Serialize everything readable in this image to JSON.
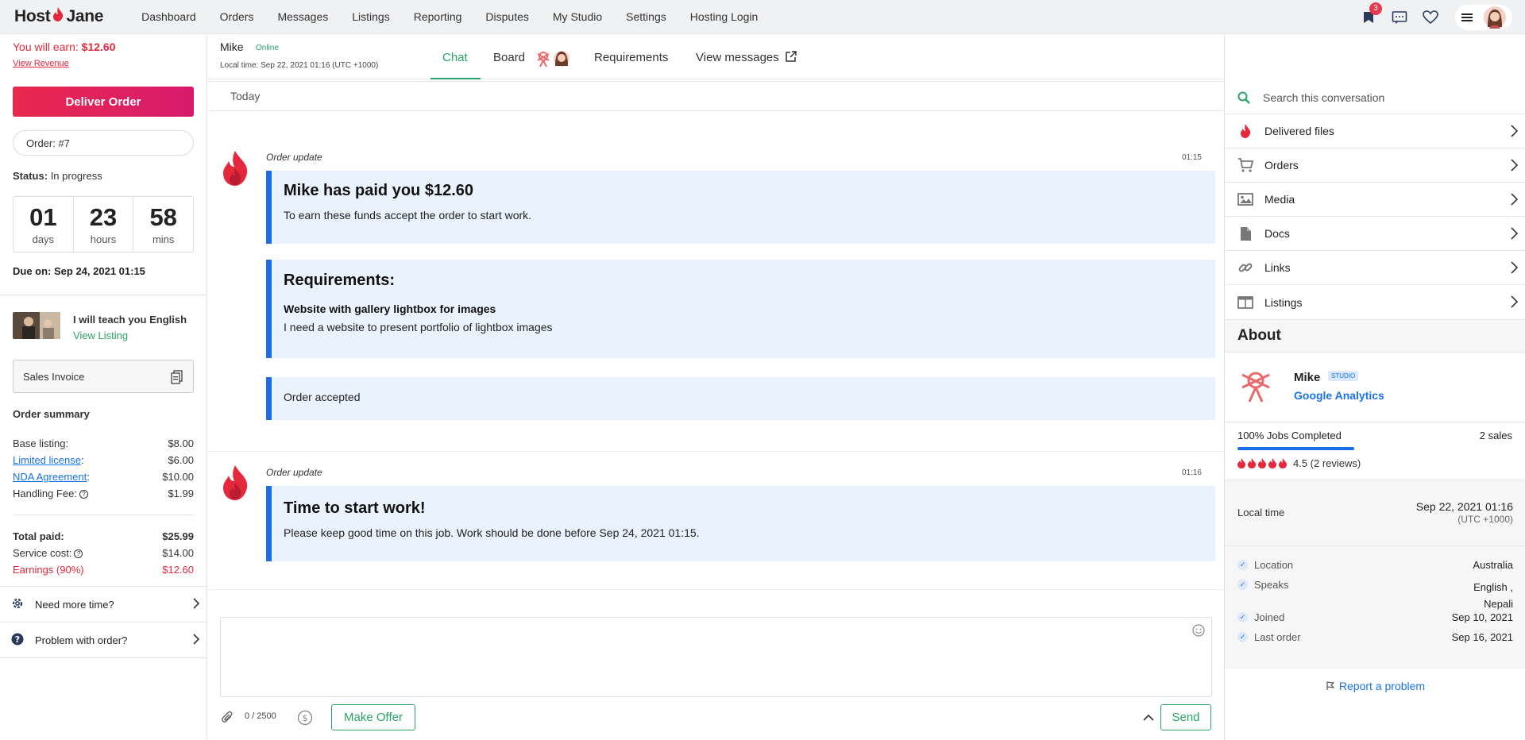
{
  "brand": {
    "name_left": "Host",
    "name_right": "Jane"
  },
  "nav": [
    "Dashboard",
    "Orders",
    "Messages",
    "Listings",
    "Reporting",
    "Disputes",
    "My Studio",
    "Settings",
    "Hosting Login"
  ],
  "topbar": {
    "notification_count": "3",
    "icons": [
      "bell-icon",
      "chat-icon",
      "heart-icon",
      "menu-icon",
      "avatar"
    ]
  },
  "sidebar": {
    "earn_label": "You will earn:",
    "earn_value": "$12.60",
    "view_revenue": "View Revenue",
    "deliver_button": "Deliver Order",
    "order_label": "Order: #7",
    "status_label": "Status:",
    "status_value": "In progress",
    "countdown": [
      {
        "value": "01",
        "unit": "days"
      },
      {
        "value": "23",
        "unit": "hours"
      },
      {
        "value": "58",
        "unit": "mins"
      }
    ],
    "due": "Due on: Sep 24, 2021 01:15",
    "listing_title": "I will teach you English",
    "view_listing": "View Listing",
    "invoice": "Sales Invoice",
    "summary_heading": "Order summary",
    "summary": {
      "base_label": "Base listing:",
      "base_value": "$8.00",
      "license_label": "Limited license",
      "license_value": "$6.00",
      "nda_label": "NDA Agreement",
      "nda_value": "$10.00",
      "handling_label": "Handling Fee:",
      "handling_value": "$1.99",
      "total_label": "Total paid:",
      "total_value": "$25.99",
      "service_label": "Service cost:",
      "service_value": "$14.00",
      "earnings_label": "Earnings (90%)",
      "earnings_value": "$12.60"
    },
    "more_time": "Need more time?",
    "problem": "Problem with order?"
  },
  "chat": {
    "contact_name": "Mike",
    "online": "Online",
    "local_time": "Local time:  Sep 22, 2021 01:16 (UTC +1000)",
    "tabs": [
      "Chat",
      "Board",
      "Requirements",
      "View messages"
    ],
    "active_tab": "Chat",
    "day_divider": "Today",
    "messages": [
      {
        "label": "Order update",
        "time": "01:15",
        "paid_title": "Mike has paid you $12.60",
        "paid_text": "To earn these funds accept the order to start work.",
        "req_title": "Requirements:",
        "req_sub": "Website with gallery lightbox for images",
        "req_text": "I need a website to present portfolio of lightbox images",
        "accepted": "Order accepted"
      },
      {
        "label": "Order update",
        "time": "01:16",
        "title": "Time to start work!",
        "text": "Please keep good time on this job. Work should be done before Sep 24, 2021 01:15."
      }
    ],
    "composer_value": "",
    "counter": "0 / 2500",
    "make_offer": "Make Offer",
    "send": "Send"
  },
  "panel": {
    "search_placeholder": "Search this conversation",
    "items": [
      "Delivered files",
      "Orders",
      "Media",
      "Docs",
      "Links",
      "Listings"
    ],
    "about_heading": "About",
    "agent_name": "Mike",
    "agent_tag": "STUDIO",
    "agent_link": "Google Analytics",
    "jobs_completed": "100% Jobs Completed",
    "jobs_fraction": 1.0,
    "sales": "2 sales",
    "rating_text": "4.5 (2 reviews)",
    "rating_value": 4.5,
    "local_time_label": "Local time",
    "local_time_value": "Sep 22, 2021 01:16",
    "local_time_zone": "(UTC +1000)",
    "location_label": "Location",
    "location_value": "Australia",
    "speaks_label": "Speaks",
    "speaks_value_1": "English ,",
    "speaks_value_2": "Nepali",
    "joined_label": "Joined",
    "joined_value": "Sep 10, 2021",
    "last_order_label": "Last order",
    "last_order_value": "Sep 16, 2021",
    "report": "Report a problem"
  },
  "colors": {
    "accent_green": "#29a36a",
    "brand_red": "#e5283c",
    "link_blue": "#1a73e8",
    "card_bg": "#eaf2fe",
    "card_border": "#1a6ee8"
  }
}
